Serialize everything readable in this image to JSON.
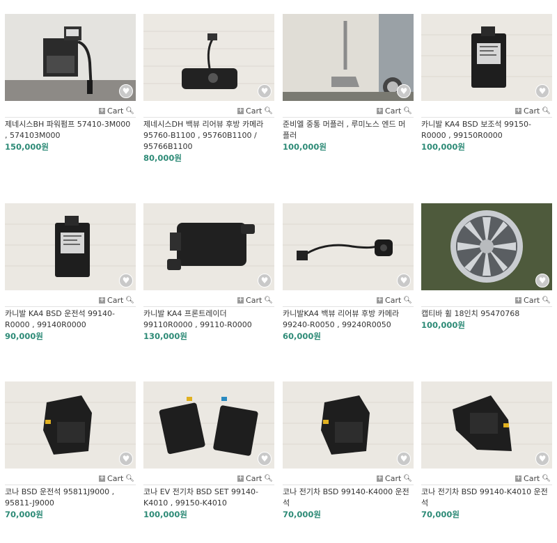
{
  "cart_label": "Cart",
  "products": [
    {
      "name": "제네시스BH 파워펌프 57410-3M000 , 574103M000",
      "price": "150,000원",
      "image": "power-pump"
    },
    {
      "name": "제네시스DH 백뷰 리어뷰 후방 카메라 95760-B1100 , 95760B1100 / 95766B1100",
      "price": "80,000원",
      "image": "rear-camera"
    },
    {
      "name": "준비엘 중통 머플러 , 루미노스 엔드 머플러",
      "price": "100,000원",
      "image": "muffler"
    },
    {
      "name": "카니발 KA4 BSD 보조석 99150-R0000 , 99150R0000",
      "price": "100,000원",
      "image": "bsd-module"
    },
    {
      "name": "카니발 KA4 BSD 운전석 99140-R0000 , 99140R0000",
      "price": "90,000원",
      "image": "bsd-module"
    },
    {
      "name": "카니발 KA4 프론트레이더 99110R0000 , 99110-R0000",
      "price": "130,000원",
      "image": "radar"
    },
    {
      "name": "카니발KA4 백뷰 리어뷰 후방 카메라 99240-R0050 , 99240R0050",
      "price": "60,000원",
      "image": "camera-cable"
    },
    {
      "name": "캡티바 휠 18인치 95470768",
      "price": "100,000원",
      "image": "wheel"
    },
    {
      "name": "코나 BSD 운전석 95811J9000 , 95811-J9000",
      "price": "70,000원",
      "image": "bsd-bracket"
    },
    {
      "name": "코나 EV 전기차 BSD SET 99140-K4010 , 99150-K4010",
      "price": "100,000원",
      "image": "bsd-set"
    },
    {
      "name": "코나 전기차 BSD 99140-K4000 운전석",
      "price": "70,000원",
      "image": "bsd-bracket"
    },
    {
      "name": "코나 전기차 BSD 99140-K4010 운전석",
      "price": "70,000원",
      "image": "bsd-bracket-2"
    }
  ]
}
